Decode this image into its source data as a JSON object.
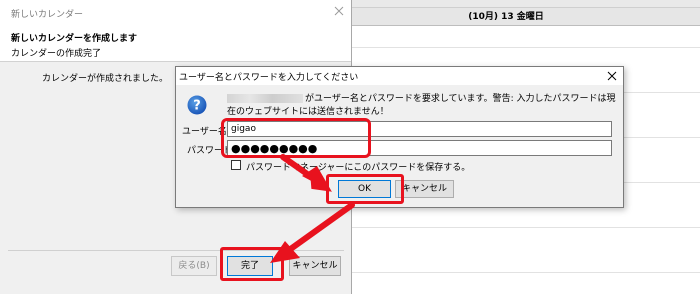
{
  "calendar": {
    "top_cut_text": "(10)(月)13(金曜日)",
    "day_header": "(10月) 13 金曜日"
  },
  "wizard": {
    "window_title": "新しいカレンダー",
    "header_title": "新しいカレンダーを作成します",
    "header_subtitle": "カレンダーの作成完了",
    "body_text": "カレンダーが作成されました。",
    "back_label": "戻る(B)",
    "done_label": "完了",
    "cancel_label": "キャンセル",
    "icons": {
      "close": "close-icon"
    }
  },
  "password_dialog": {
    "title": "ユーザー名とパスワードを入力してください",
    "message": "がユーザー名とパスワードを要求しています。警告: 入力したパスワードは現在のウェブサイトには送信されません！",
    "username_label": "ユーザー名:",
    "username_value": "gigao",
    "password_label": "パスワード:",
    "password_value": "●●●●●●●●●",
    "save_checkbox_label": "パスワードマネージャーにこのパスワードを保存する。",
    "save_checked": false,
    "ok_label": "OK",
    "cancel_label": "キャンセル",
    "icons": {
      "info": "question-icon",
      "close": "close-icon"
    }
  },
  "annotation": {
    "color": "#e8121e"
  }
}
